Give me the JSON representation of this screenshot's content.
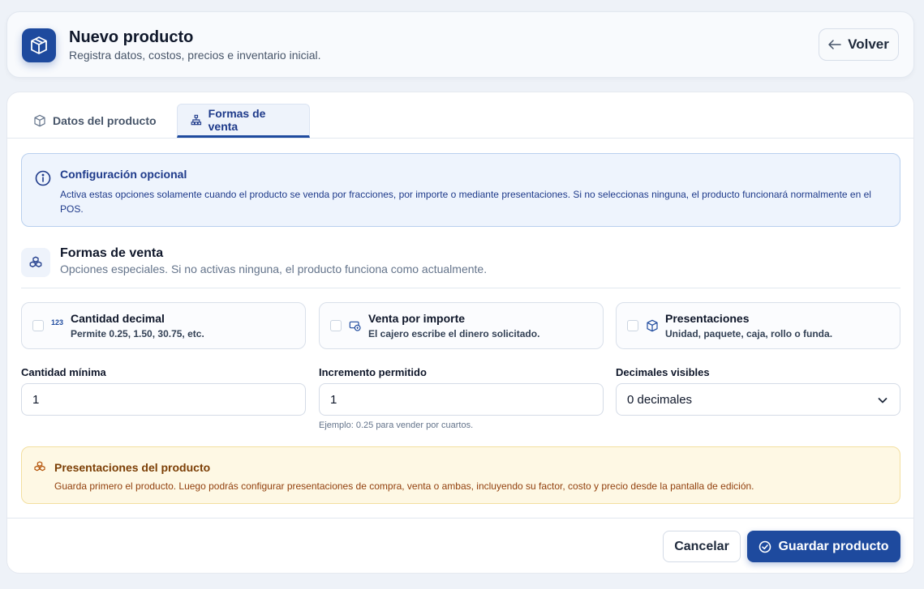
{
  "header": {
    "title": "Nuevo producto",
    "subtitle": "Registra datos, costos, precios e inventario inicial.",
    "back_label": "Volver",
    "icon": "box-icon"
  },
  "tabs": [
    {
      "label": "Datos del producto",
      "icon": "box-icon",
      "active": false
    },
    {
      "label": "Formas de venta",
      "icon": "sitemap-icon",
      "active": true
    }
  ],
  "info": {
    "title": "Configuración opcional",
    "text": "Activa estas opciones solamente cuando el producto se venda por fracciones, por importe o mediante presentaciones. Si no seleccionas ninguna, el producto funcionará normalmente en el POS."
  },
  "formas_venta": {
    "title": "Formas de venta",
    "subtitle": "Opciones especiales. Si no activas ninguna, el producto funciona como actualmente."
  },
  "options": [
    {
      "icon_text": "123",
      "title": "Cantidad decimal",
      "subtitle": "Permite 0.25, 1.50, 30.75, etc.",
      "checked": false
    },
    {
      "icon_text": "",
      "title": "Venta por importe",
      "subtitle": "El cajero escribe el dinero solicitado.",
      "checked": false
    },
    {
      "icon_text": "",
      "title": "Presentaciones",
      "subtitle": "Unidad, paquete, caja, rollo o funda.",
      "checked": false
    }
  ],
  "fields": {
    "cantidad_minima": {
      "label": "Cantidad mínima",
      "value": "1"
    },
    "incremento": {
      "label": "Incremento permitido",
      "value": "1",
      "hint": "Ejemplo: 0.25 para vender por cuartos."
    },
    "decimales": {
      "label": "Decimales visibles",
      "value": "0 decimales"
    }
  },
  "warning": {
    "title": "Presentaciones del producto",
    "text": "Guarda primero el producto. Luego podrás configurar presentaciones de compra, venta o ambas, incluyendo su factor, costo y precio desde la pantalla de edición."
  },
  "footer": {
    "cancel_label": "Cancelar",
    "save_label": "Guardar producto"
  },
  "colors": {
    "primary": "#1e4a9e",
    "info_bg": "#eef4fd",
    "warning_bg": "#fef8e4"
  }
}
